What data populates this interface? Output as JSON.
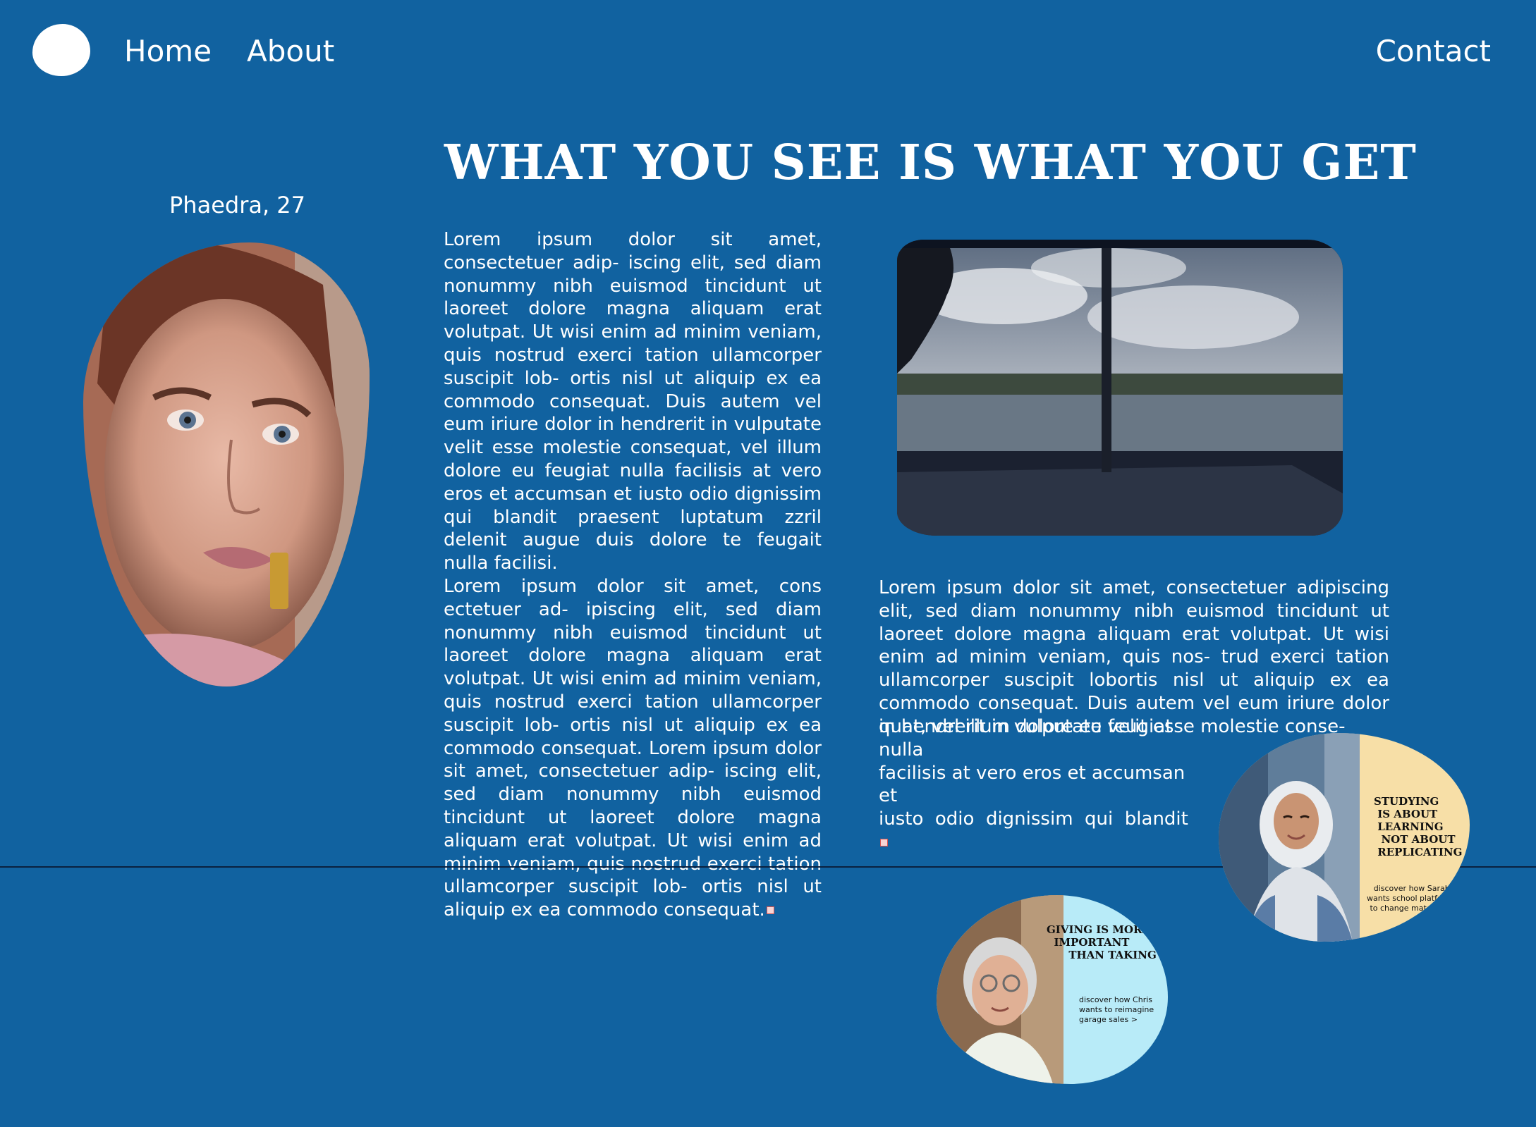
{
  "nav": {
    "home_label": "Home",
    "about_label": "About",
    "contact_label": "Contact"
  },
  "headline": "WHAT YOU SEE IS WHAT YOU GET",
  "profile": {
    "caption": "Phaedra, 27"
  },
  "main_text": {
    "column1": [
      "Lorem ipsum dolor sit amet, consectetuer adip- iscing elit, sed diam nonummy nibh euismod tincidunt ut laoreet dolore magna aliquam erat volutpat. Ut wisi enim ad minim veniam, quis nostrud exerci tation ullamcorper suscipit lob- ortis nisl ut aliquip ex ea commodo consequat. Duis autem vel eum iriure dolor in hendrerit in vulputate velit esse molestie consequat, vel illum dolore eu feugiat nulla facilisis at vero eros et accumsan et iusto odio dignissim qui blandit praesent luptatum zzril delenit augue duis dolore te feugait nulla facilisi.",
      "Lorem ipsum dolor sit amet, cons ectetuer ad- ipiscing elit, sed diam nonummy nibh euismod tincidunt ut laoreet dolore magna aliquam erat volutpat. Ut wisi enim ad minim veniam, quis nostrud exerci tation ullamcorper suscipit lob- ortis nisl ut aliquip ex ea commodo consequat. Lorem ipsum dolor sit amet, consectetuer adip- iscing elit, sed diam nonummy nibh euismod tincidunt ut laoreet dolore magna aliquam erat volutpat. Ut wisi enim ad minim veniam, quis nostrud exerci tation ullamcorper suscipit lob- ortis nisl ut aliquip ex ea commodo consequat."
    ],
    "column2": "Lorem ipsum dolor sit amet, consectetuer adipiscing elit, sed diam nonummy nibh euismod tincidunt ut laoreet dolore magna aliquam erat volutpat. Ut wisi enim ad minim veniam, quis nos- trud exerci tation ullamcorper suscipit lobortis nisl ut aliquip ex ea commodo consequat. Duis autem vel eum iriure dolor in hendrerit in vulputate velit esse molestie conse-",
    "column2_tail": [
      "quat, vel illum dolore eu feugiat nulla",
      "facilisis at vero eros et accumsan et",
      "iusto  odio  dignissim  qui  blandit"
    ]
  },
  "cards": [
    {
      "title": "STUDYING\n IS ABOUT\n LEARNING\n  NOT ABOUT\n REPLICATING",
      "link": "discover how Sarah\nwants school platforms\nto change matches >",
      "bg": "#f7dfa7"
    },
    {
      "title": "GIVING IS MORE\n  IMPORTANT\n      THAN TAKING",
      "link": "discover how Chris\nwants to reimagine\ngarage sales >",
      "bg": "#b8ebf8"
    }
  ],
  "colors": {
    "background": "#1162a0",
    "text": "#ffffff"
  }
}
